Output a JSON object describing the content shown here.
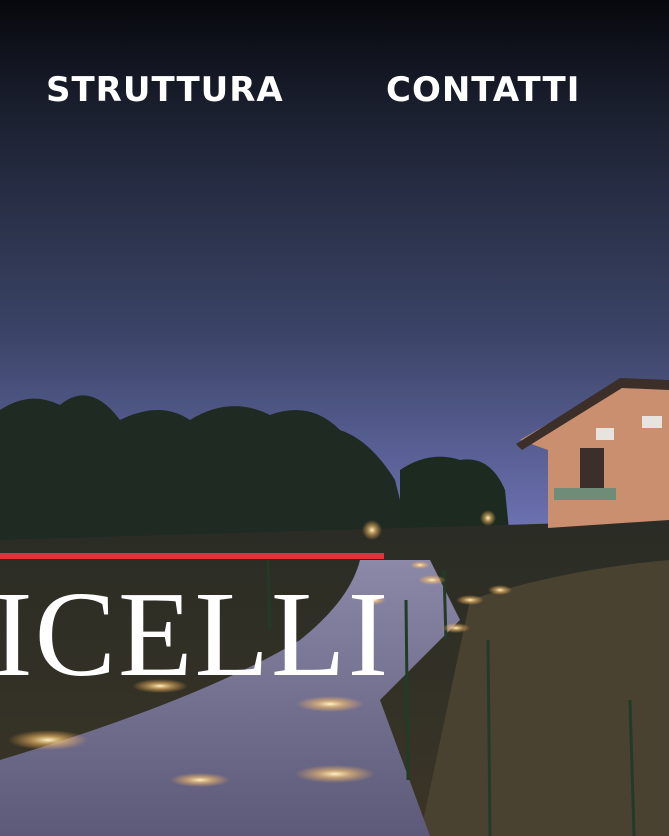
{
  "nav": {
    "items": [
      {
        "label": "STRUTTURA"
      },
      {
        "label": "CONTATTI"
      }
    ]
  },
  "hero": {
    "title_fragment": "ICELLI"
  },
  "colors": {
    "accent": "#e0343a",
    "sky_top": "#0a0c14",
    "sky_mid": "#3a4468",
    "sky_bottom": "#8a8ed0",
    "text": "#ffffff"
  }
}
